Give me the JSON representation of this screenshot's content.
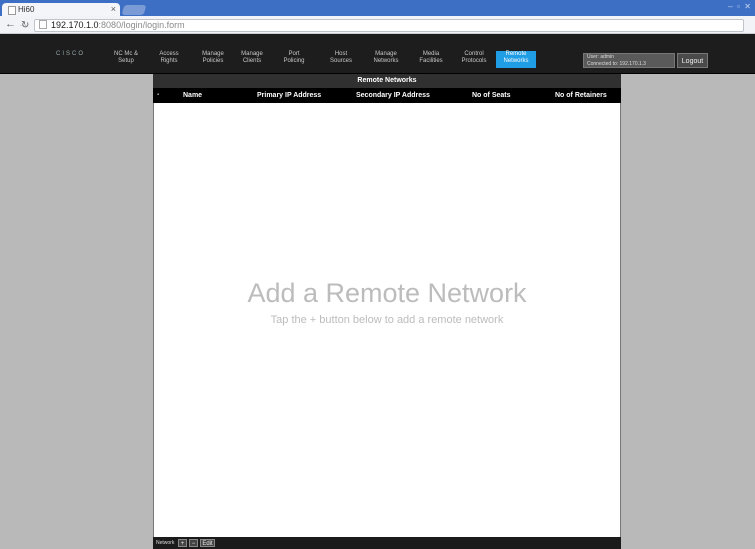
{
  "browser": {
    "tab_title": "Hi60",
    "tab_close": "×",
    "url_host": "192.170.1.0",
    "url_path": ":8080/login/login.form"
  },
  "app": {
    "logo": "CISCO",
    "menu": [
      {
        "label": "NC Mc &\nSetup"
      },
      {
        "label": "Access\nRights"
      },
      {
        "label": "Manage\nPolicies"
      },
      {
        "label": "Manage\nClients"
      },
      {
        "label": "Port\nPolicing"
      },
      {
        "label": "Host\nSources"
      },
      {
        "label": "Manage\nNetworks"
      },
      {
        "label": "Media\nFacilities"
      },
      {
        "label": "Control\nProtocols"
      },
      {
        "label": "Remote\nNetworks"
      }
    ],
    "user": {
      "line1": "User: admin",
      "line2": "Connected to: 192.170.1.3"
    },
    "logout_label": "Logout"
  },
  "panel": {
    "title": "Remote Networks",
    "columns": [
      "Name",
      "Primary IP Address",
      "Secondary IP Address",
      "No of Seats",
      "No of Retainers"
    ],
    "empty_title": "Add a Remote Network",
    "empty_subtitle": "Tap the + button below to add a remote network"
  },
  "footer": {
    "label": "Network",
    "add": "+",
    "remove": "−",
    "edit": "Edit"
  }
}
